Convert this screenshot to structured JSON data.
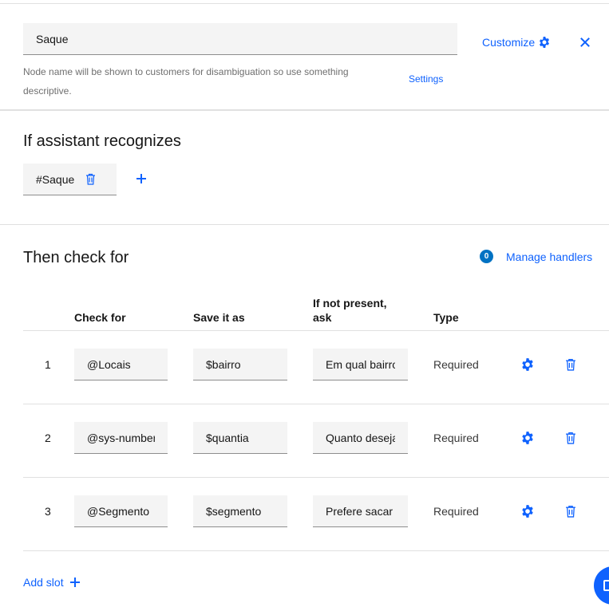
{
  "node": {
    "name_value": "Saque",
    "helper_text": "Node name will be shown to customers for disambiguation so use something descriptive.",
    "settings_label": "Settings",
    "customize_label": "Customize"
  },
  "recognizes": {
    "title": "If assistant recognizes",
    "condition": "#Saque"
  },
  "check": {
    "title": "Then check for",
    "handlers_count": "0",
    "handlers_label": "Manage handlers",
    "columns": {
      "check_for": "Check for",
      "save_as": "Save it as",
      "ask_line1": "If not present,",
      "ask_line2": "ask",
      "type": "Type"
    },
    "slots": [
      {
        "num": "1",
        "check_for": "@Locais",
        "save_as": "$bairro",
        "ask": "Em qual bairro",
        "type": "Required"
      },
      {
        "num": "2",
        "check_for": "@sys-number",
        "save_as": "$quantia",
        "ask": "Quanto deseja",
        "type": "Required"
      },
      {
        "num": "3",
        "check_for": "@Segmento",
        "save_as": "$segmento",
        "ask": "Prefere sacar",
        "type": "Required"
      }
    ],
    "add_slot_label": "Add slot"
  },
  "colors": {
    "accent": "#0f62fe",
    "badge": "#0072c3"
  }
}
